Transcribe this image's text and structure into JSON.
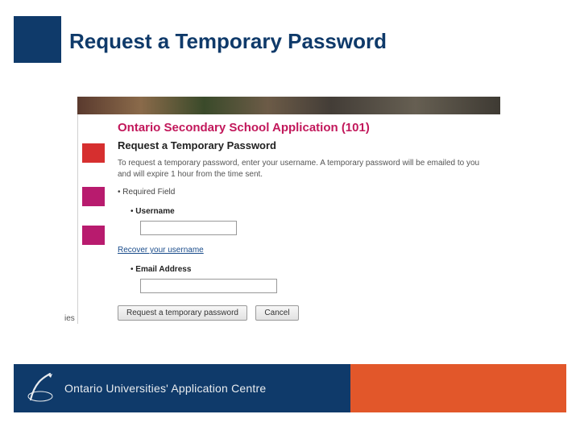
{
  "slide": {
    "title": "Request a Temporary Password"
  },
  "page": {
    "appTitle": "Ontario Secondary School Application (101)",
    "heading": "Request a Temporary Password",
    "instruction": "To request a temporary password, enter your username. A temporary password will be emailed to you and will expire 1 hour from the time sent.",
    "requiredField": "Required Field",
    "fields": {
      "usernameLabel": "Username",
      "emailLabel": "Email Address"
    },
    "recoverLink": "Recover your username",
    "buttons": {
      "submit": "Request a temporary password",
      "cancel": "Cancel"
    }
  },
  "footer": {
    "org": "Ontario Universities' Application Centre"
  }
}
